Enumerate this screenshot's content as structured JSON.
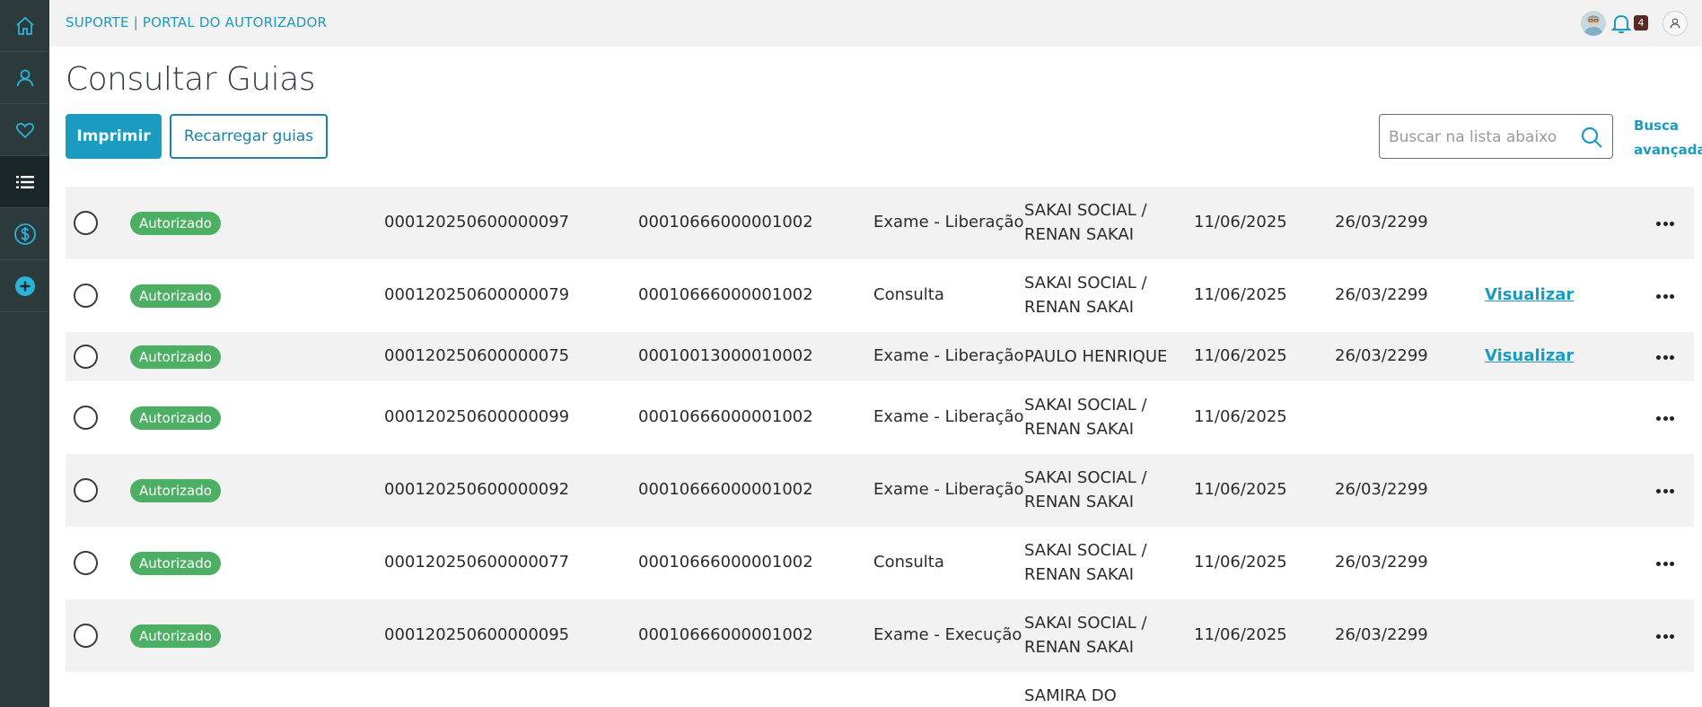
{
  "app": {
    "brand": "SUPORTE | PORTAL DO AUTORIZADOR",
    "notifications_count": "4"
  },
  "sidebar": {
    "items": [
      {
        "icon": "home-icon",
        "active": false
      },
      {
        "icon": "user-icon",
        "active": false
      },
      {
        "icon": "heart-icon",
        "active": false
      },
      {
        "icon": "list-icon",
        "active": true
      },
      {
        "icon": "dollar-icon",
        "active": false
      },
      {
        "icon": "plus-circle-icon",
        "active": false
      }
    ]
  },
  "page": {
    "title": "Consultar Guias",
    "print_label": "Imprimir",
    "reload_label": "Recarregar guias",
    "search_placeholder": "Buscar na lista abaixo",
    "adv_search_line1": "Busca",
    "adv_search_line2": "avançada"
  },
  "colors": {
    "accent": "#1a9bbf",
    "sidebar": "#2c3a3c",
    "status_green": "#4caf63"
  },
  "rows": [
    {
      "status": "Autorizado",
      "guia": "000120250600000097",
      "carteira": "00010666000001002",
      "tipo": "Exame - Liberação",
      "name1": "SAKAI SOCIAL /",
      "name2": "RENAN SAKAI",
      "date1": "11/06/2025",
      "date2": "26/03/2299",
      "link": ""
    },
    {
      "status": "Autorizado",
      "guia": "000120250600000079",
      "carteira": "00010666000001002",
      "tipo": "Consulta",
      "name1": "SAKAI SOCIAL /",
      "name2": "RENAN SAKAI",
      "date1": "11/06/2025",
      "date2": "26/03/2299",
      "link": "Visualizar"
    },
    {
      "status": "Autorizado",
      "guia": "000120250600000075",
      "carteira": "00010013000010002",
      "tipo": "Exame - Liberação",
      "name1": "PAULO HENRIQUE",
      "name2": "",
      "date1": "11/06/2025",
      "date2": "26/03/2299",
      "link": "Visualizar"
    },
    {
      "status": "Autorizado",
      "guia": "000120250600000099",
      "carteira": "00010666000001002",
      "tipo": "Exame - Liberação",
      "name1": "SAKAI SOCIAL /",
      "name2": "RENAN SAKAI",
      "date1": "11/06/2025",
      "date2": "",
      "link": ""
    },
    {
      "status": "Autorizado",
      "guia": "000120250600000092",
      "carteira": "00010666000001002",
      "tipo": "Exame - Liberação",
      "name1": "SAKAI SOCIAL /",
      "name2": "RENAN SAKAI",
      "date1": "11/06/2025",
      "date2": "26/03/2299",
      "link": ""
    },
    {
      "status": "Autorizado",
      "guia": "000120250600000077",
      "carteira": "00010666000001002",
      "tipo": "Consulta",
      "name1": "SAKAI SOCIAL /",
      "name2": "RENAN SAKAI",
      "date1": "11/06/2025",
      "date2": "26/03/2299",
      "link": ""
    },
    {
      "status": "Autorizado",
      "guia": "000120250600000095",
      "carteira": "00010666000001002",
      "tipo": "Exame - Execução",
      "name1": "SAKAI SOCIAL /",
      "name2": "RENAN SAKAI",
      "date1": "11/06/2025",
      "date2": "26/03/2299",
      "link": ""
    },
    {
      "status": "",
      "guia": "",
      "carteira": "",
      "tipo": "",
      "name1": "SAMIRA DO",
      "name2": "",
      "date1": "",
      "date2": "",
      "link": ""
    }
  ]
}
